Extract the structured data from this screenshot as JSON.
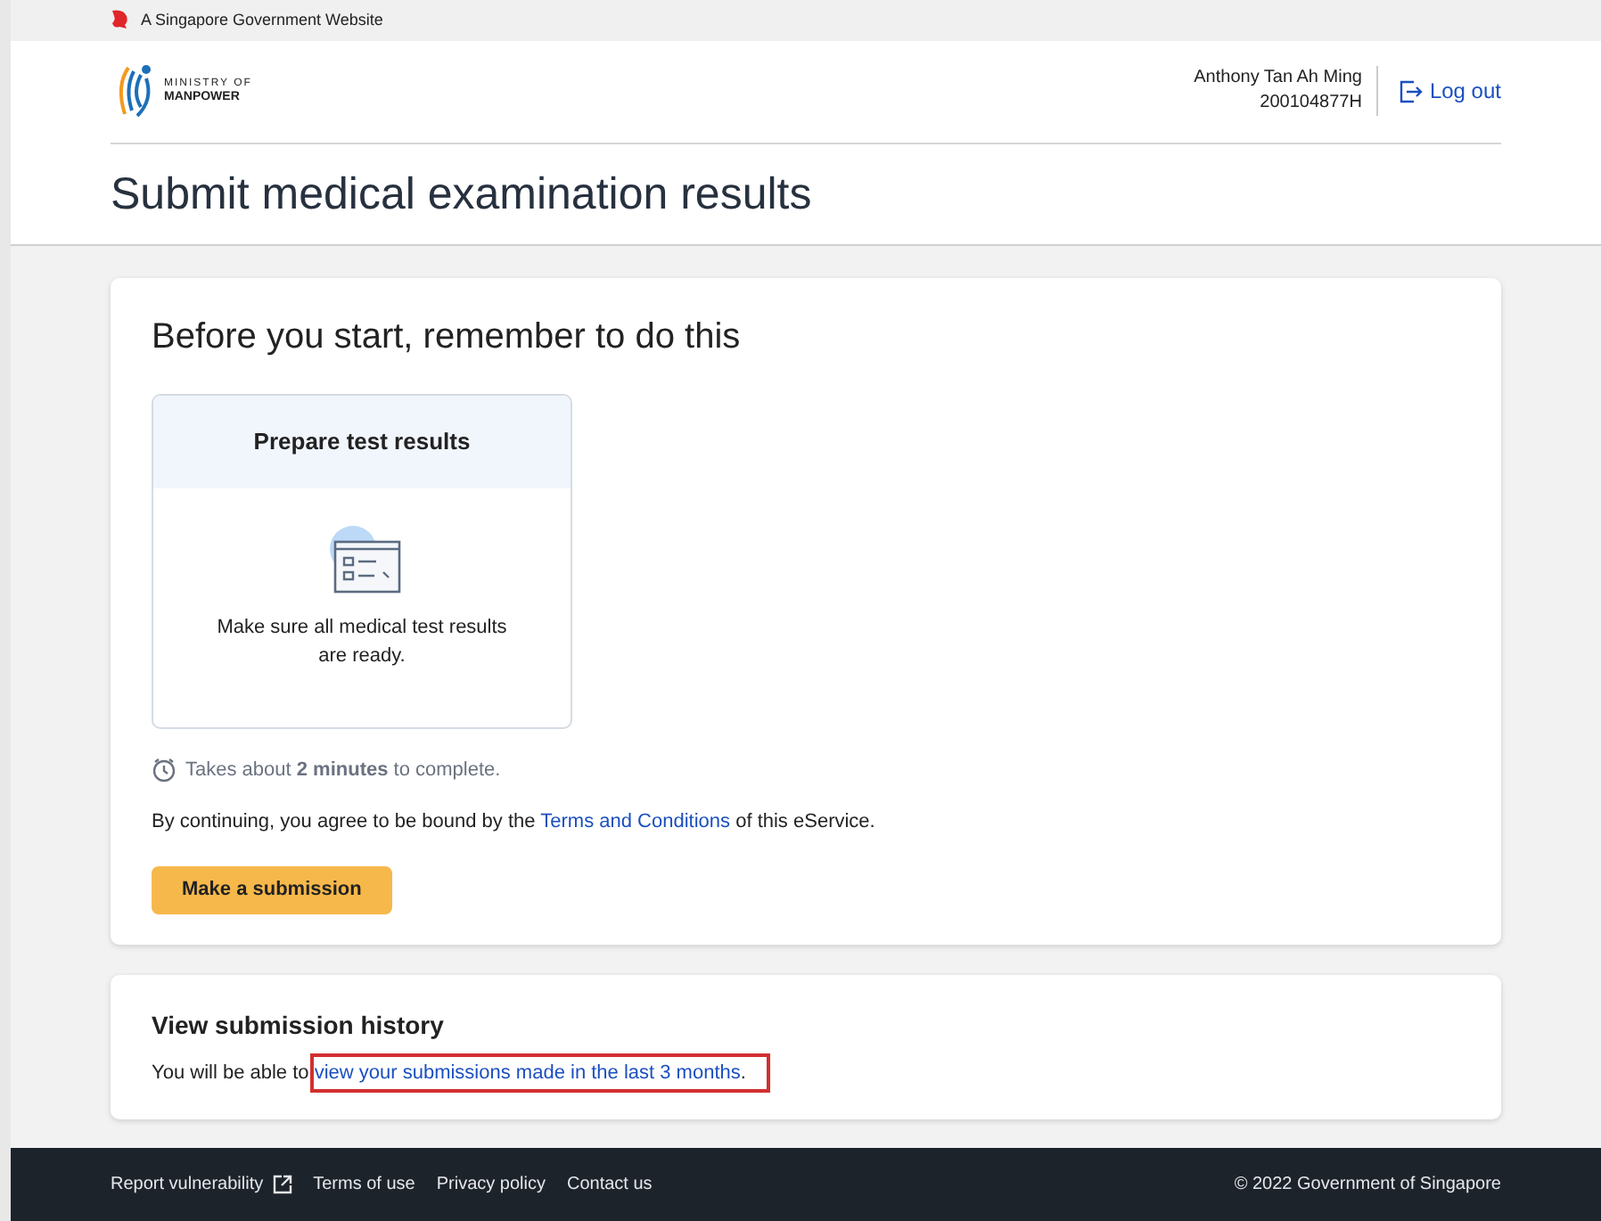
{
  "gov_banner": {
    "text": "A Singapore Government Website"
  },
  "header": {
    "logo_line_1": "MINISTRY OF",
    "logo_line_2": "MANPOWER",
    "user_name": "Anthony Tan Ah Ming",
    "user_id": "200104877H",
    "logout": "Log out"
  },
  "page_title": "Submit medical examination results",
  "start_card": {
    "heading": "Before you start, remember to do this",
    "steps": [
      {
        "title": "Prepare test results",
        "description": "Make sure all medical test results are ready."
      }
    ],
    "duration": "Takes about **2 minutes** to complete.",
    "agreement": {
      "before": "By continuing, you agree to be bound by the ",
      "link": "Terms and Conditions",
      "after": " of this eService."
    },
    "button": "Make a submission"
  },
  "history_card": {
    "heading": "View submission history",
    "before": "You will be able to ",
    "link": "view your submissions made in the last 3 months",
    "after": ".",
    "link_highlighted": true
  },
  "footer": {
    "links": [
      {
        "label": "Report vulnerability",
        "external": true
      },
      {
        "label": "Terms of use",
        "external": false
      },
      {
        "label": "Privacy policy",
        "external": false
      },
      {
        "label": "Contact us",
        "external": false
      }
    ],
    "copyright": "© 2022 Government of Singapore"
  }
}
